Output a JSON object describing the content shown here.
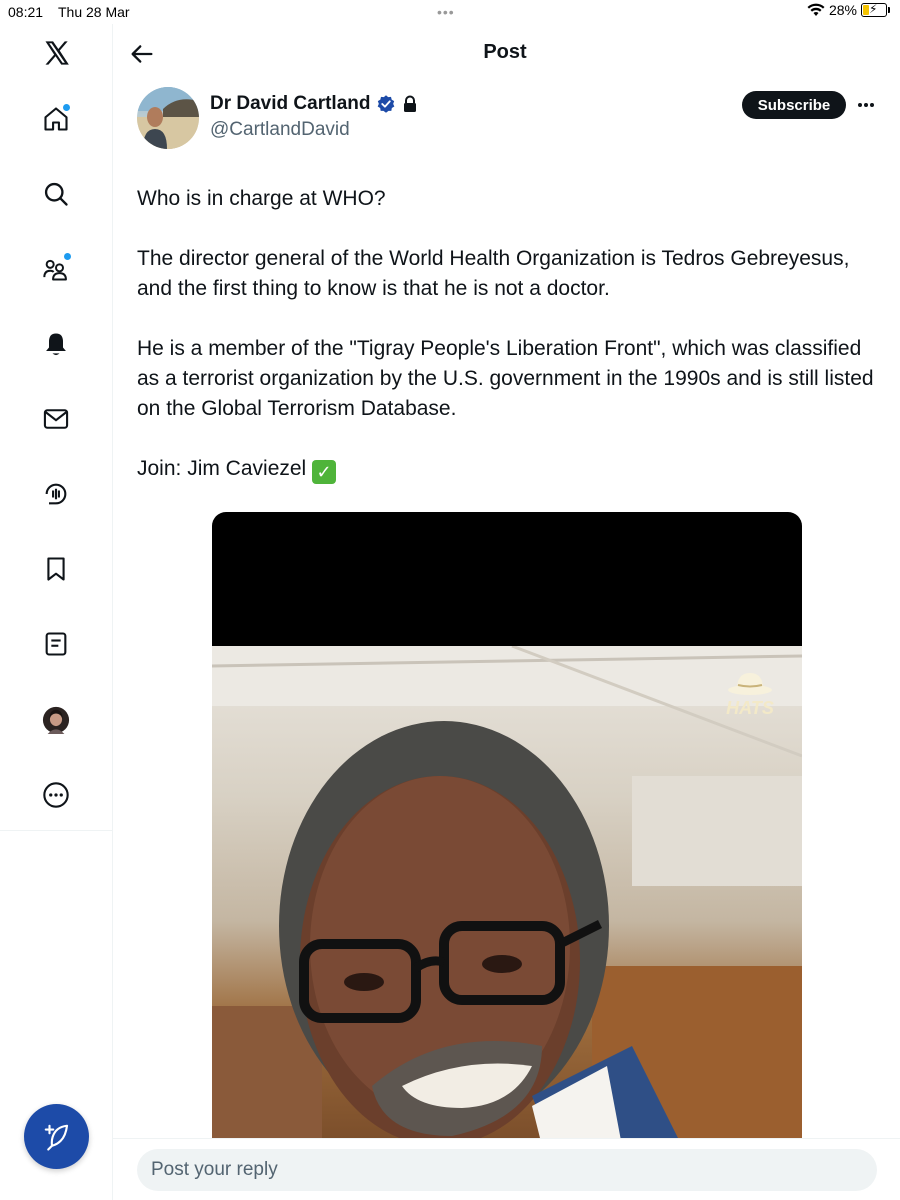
{
  "status_bar": {
    "time": "08:21",
    "date": "Thu 28 Mar",
    "battery": "28%",
    "battery_level": 0.28
  },
  "sidebar": {
    "items": [
      {
        "name": "x-logo-icon"
      },
      {
        "name": "home-icon",
        "has_dot": true
      },
      {
        "name": "search-icon"
      },
      {
        "name": "communities-icon",
        "has_dot": true
      },
      {
        "name": "notifications-icon"
      },
      {
        "name": "messages-icon"
      },
      {
        "name": "grok-icon"
      },
      {
        "name": "bookmarks-icon"
      },
      {
        "name": "lists-icon"
      },
      {
        "name": "profile-avatar"
      },
      {
        "name": "more-options-icon"
      }
    ],
    "compose_icon": "compose-post-icon",
    "accent_color": "#1d9bf0"
  },
  "header": {
    "title": "Post"
  },
  "post": {
    "author_name": "Dr David Cartland",
    "author_handle": "@CartlandDavid",
    "verified_color": "#1d4ba8",
    "subscribe_label": "Subscribe",
    "paragraphs": [
      "Who is in charge at WHO?",
      "The director general of the World Health Organization is Tedros Gebreyesus, and the first thing to know is that he is not a doctor.",
      "He is a member of the \"Tigray People's Liberation Front\", which was classified as a terrorist organization by the U.S. government in the 1990s and is still listed on the Global Terrorism Database.",
      "Join: Jim Caviezel"
    ],
    "join_emoji": "✓",
    "media_watermark": "HATS"
  },
  "reply": {
    "placeholder": "Post your reply"
  }
}
